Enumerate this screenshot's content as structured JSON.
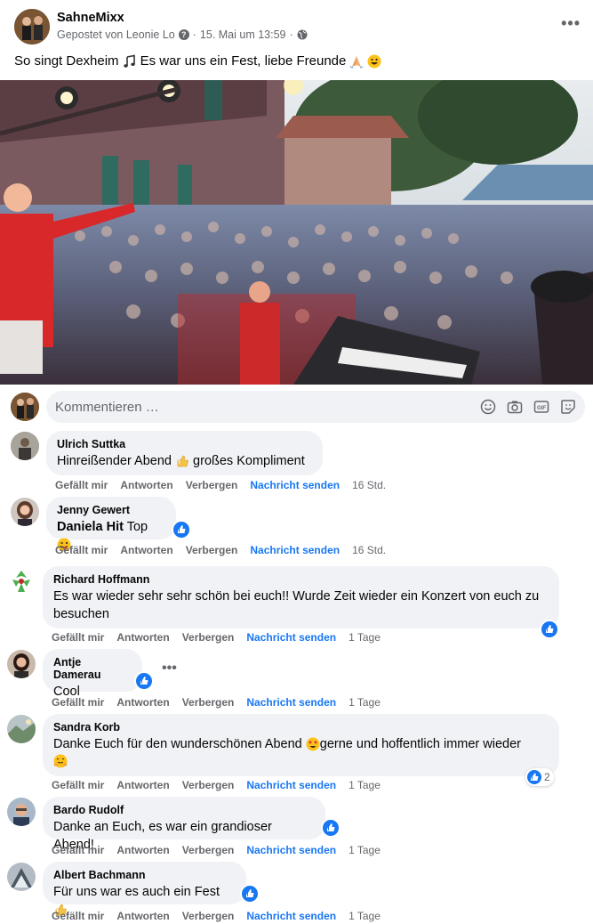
{
  "post": {
    "page_name": "SahneMixx",
    "posted_by": "Gepostet von Leonie Lo",
    "date": "15. Mai um 13:59",
    "text_part1": "So singt Dexheim",
    "text_part2": "Es war uns ein  Fest, liebe Freunde"
  },
  "composer": {
    "placeholder": "Kommentieren …"
  },
  "actions": {
    "like": "Gefällt mir",
    "reply": "Antworten",
    "hide": "Verbergen",
    "message": "Nachricht senden"
  },
  "comments": [
    {
      "name": "Ulrich Suttka",
      "text": "Hinreißender Abend",
      "text2": "großes Kompliment",
      "time": "16 Std."
    },
    {
      "name": "Jenny Gewert",
      "text_bold": "Daniela Hit",
      "text": "Top",
      "time": "16 Std."
    },
    {
      "name": "Richard Hoffmann",
      "text": "Es war wieder sehr sehr schön bei euch!! Wurde Zeit wieder ein Konzert von euch zu",
      "text2": "besuchen",
      "time": "1 Tage"
    },
    {
      "name": "Antje Damerau",
      "text": "Cool",
      "time": "1 Tage"
    },
    {
      "name": "Sandra Korb",
      "text": "Danke Euch für den wunderschönen Abend",
      "text2": "gerne und hoffentlich immer wieder",
      "time": "1 Tage",
      "reaction_count": "2"
    },
    {
      "name": "Bardo Rudolf",
      "text": "Danke an Euch, es war ein grandioser Abend!",
      "time": "1 Tage"
    },
    {
      "name": "Albert Bachmann",
      "text": "Für uns war es auch ein Fest",
      "time": "1 Tage"
    }
  ],
  "colors": {
    "accent": "#1877f2",
    "bubble": "#f0f2f5",
    "secondary_text": "#65676b"
  }
}
